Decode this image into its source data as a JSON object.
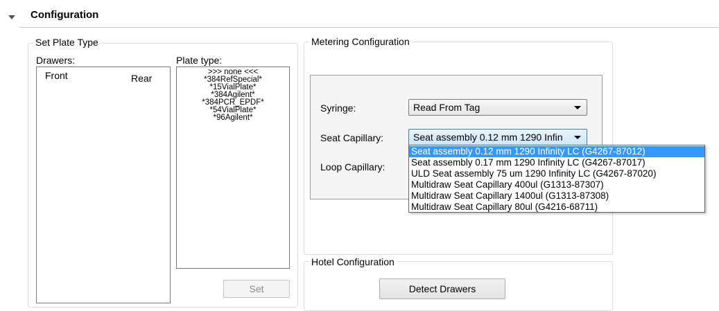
{
  "section": {
    "title": "Configuration"
  },
  "plate_group": {
    "title": "Set Plate Type",
    "drawers_label": "Drawers:",
    "drawers": [
      "Front",
      "Rear"
    ],
    "plate_type_label": "Plate type:",
    "plate_types": [
      ">>> none <<<",
      "*384RefSpecial*",
      "*15VialPlate*",
      "*384Agilent*",
      "*384PCR_EPDF*",
      "*54VialPlate*",
      "*96Agilent*"
    ],
    "set_button": "Set"
  },
  "metering": {
    "title": "Metering Configuration",
    "syringe_label": "Syringe:",
    "syringe_value": "Read From Tag",
    "seat_label": "Seat Capillary:",
    "seat_value": "Seat assembly 0.12 mm 1290 Infin",
    "loop_label": "Loop Capillary:",
    "seat_options": [
      "Seat assembly 0.12 mm 1290 Infinity LC (G4267-87012)",
      "Seat assembly 0.17 mm 1290 Infinity LC (G4267-87017)",
      "ULD Seat assembly 75 um 1290 Infinity LC (G4267-87020)",
      "Multidraw Seat Capillary 400ul (G1313-87307)",
      "Multidraw Seat Capillary 1400ul (G1313-87308)",
      "Multidraw Seat Capillary 80ul (G4216-68711)"
    ]
  },
  "hotel": {
    "title": "Hotel Configuration",
    "detect_button": "Detect Drawers"
  }
}
